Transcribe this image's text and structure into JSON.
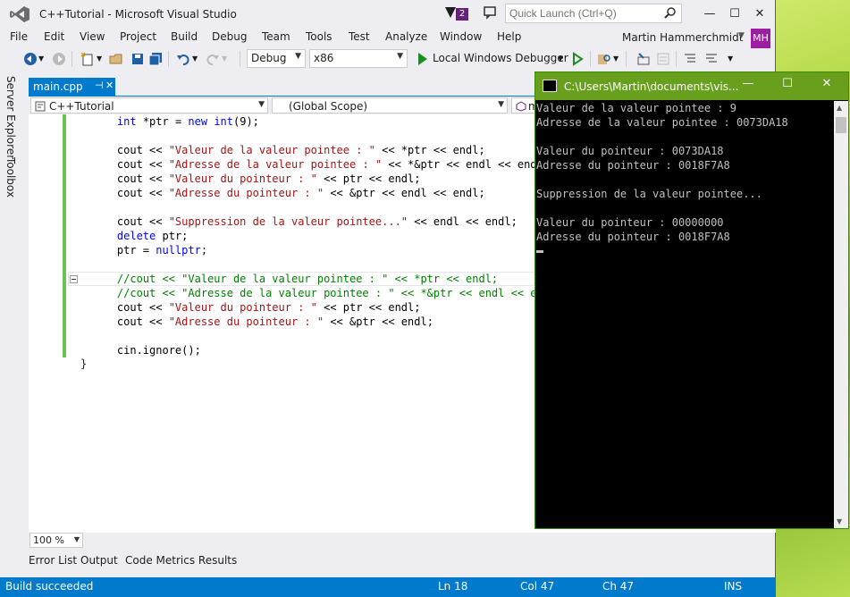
{
  "window": {
    "title": "C++Tutorial - Microsoft Visual Studio",
    "notification_count": "2",
    "quick_launch_placeholder": "Quick Launch (Ctrl+Q)",
    "minimize": "—",
    "maximize": "☐",
    "close": "✕"
  },
  "menu": {
    "items": [
      "File",
      "Edit",
      "View",
      "Project",
      "Build",
      "Debug",
      "Team",
      "Tools",
      "Test",
      "Analyze",
      "Window",
      "Help"
    ],
    "user_name": "Martin Hammerchmidt",
    "avatar_initials": "MH"
  },
  "toolbar": {
    "configuration": "Debug",
    "platform": "x86",
    "run_label": "Local Windows Debugger"
  },
  "sidebar": {
    "tabs": [
      "Server Explorer",
      "Toolbox"
    ]
  },
  "document": {
    "tab_label": "main.cpp",
    "pin_glyph": "⊣",
    "close_glyph": "✕"
  },
  "navbar": {
    "project": "C++Tutorial",
    "scope": "(Global Scope)",
    "member": "m"
  },
  "editor": {
    "lines": [
      [
        {
          "t": "    "
        },
        {
          "t": "int",
          "c": "kw"
        },
        {
          "t": " *ptr = "
        },
        {
          "t": "new",
          "c": "kw"
        },
        {
          "t": " "
        },
        {
          "t": "int",
          "c": "kw"
        },
        {
          "t": "(9);"
        }
      ],
      [],
      [
        {
          "t": "    cout << "
        },
        {
          "t": "\"Valeur de la valeur pointee : \"",
          "c": "str"
        },
        {
          "t": " << *ptr << endl;"
        }
      ],
      [
        {
          "t": "    cout << "
        },
        {
          "t": "\"Adresse de la valeur pointee : \"",
          "c": "str"
        },
        {
          "t": " << *&ptr << endl << endl;"
        }
      ],
      [
        {
          "t": "    cout << "
        },
        {
          "t": "\"Valeur du pointeur : \"",
          "c": "str"
        },
        {
          "t": " << ptr << endl;"
        }
      ],
      [
        {
          "t": "    cout << "
        },
        {
          "t": "\"Adresse du pointeur : \"",
          "c": "str"
        },
        {
          "t": " << &ptr << endl << endl;"
        }
      ],
      [],
      [
        {
          "t": "    cout << "
        },
        {
          "t": "\"Suppression de la valeur pointee...\"",
          "c": "str"
        },
        {
          "t": " << endl << endl;"
        }
      ],
      [
        {
          "t": "    "
        },
        {
          "t": "delete",
          "c": "kw"
        },
        {
          "t": " ptr;"
        }
      ],
      [
        {
          "t": "    ptr = "
        },
        {
          "t": "nullptr",
          "c": "kw"
        },
        {
          "t": ";"
        }
      ],
      [],
      [
        {
          "t": "    //cout << \"Valeur de la valeur pointee : \" << *ptr << endl;",
          "c": "cm"
        }
      ],
      [
        {
          "t": "    //cout << \"Adresse de la valeur pointee : \" << *&ptr << endl << endl;",
          "c": "cm"
        }
      ],
      [
        {
          "t": "    cout << "
        },
        {
          "t": "\"Valeur du pointeur : \"",
          "c": "str"
        },
        {
          "t": " << ptr << endl;"
        }
      ],
      [
        {
          "t": "    cout << "
        },
        {
          "t": "\"Adresse du pointeur : \"",
          "c": "str"
        },
        {
          "t": " << &ptr << endl;"
        }
      ],
      [],
      [
        {
          "t": "    cin.ignore();"
        }
      ]
    ],
    "closing_brace": "}",
    "zoom": "100 %"
  },
  "bottom_tabs": [
    "Error List",
    "Output",
    "Code Metrics Results"
  ],
  "status": {
    "message": "Build succeeded",
    "line": "Ln 18",
    "col": "Col 47",
    "ch": "Ch 47",
    "mode": "INS"
  },
  "console": {
    "title": "C:\\Users\\Martin\\documents\\vis...",
    "lines": [
      "Valeur de la valeur pointee : 9",
      "Adresse de la valeur pointee : 0073DA18",
      "",
      "Valeur du pointeur : 0073DA18",
      "Adresse du pointeur : 0018F7A8",
      "",
      "Suppression de la valeur pointee...",
      "",
      "Valeur du pointeur : 00000000",
      "Adresse du pointeur : 0018F7A8"
    ]
  },
  "colors": {
    "accent": "#007acc",
    "console_title": "#68a01e",
    "keyword": "#0000ff",
    "string": "#a31515",
    "comment": "#008000"
  }
}
